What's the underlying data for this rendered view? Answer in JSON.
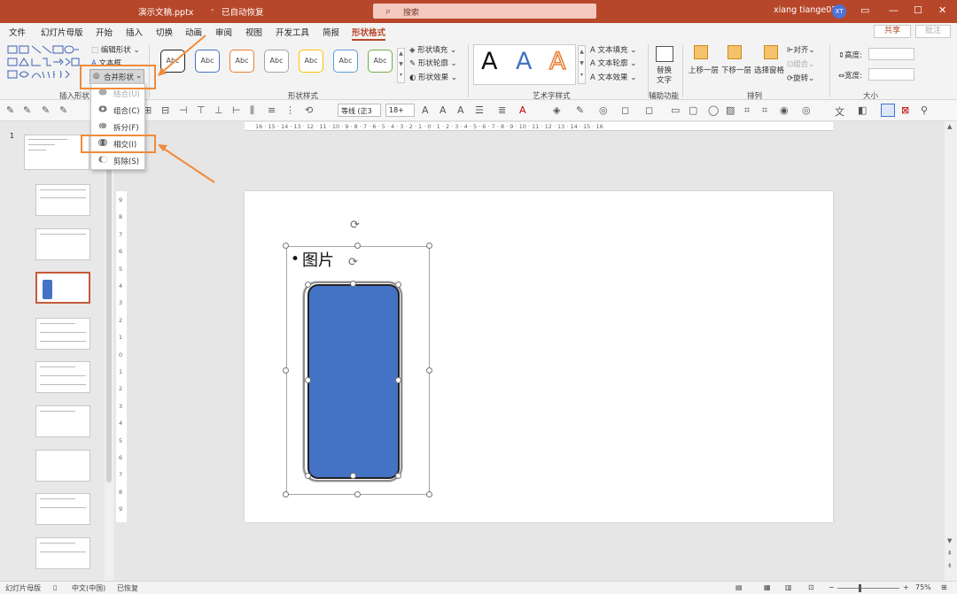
{
  "titlebar": {
    "filename": "演示文稿.pptx",
    "separator": "-",
    "autosave": "已自动恢复",
    "search_placeholder": "搜索",
    "username": "xiang tiange02",
    "avatar_initials": "XT"
  },
  "tabs": [
    "文件",
    "幻灯片母版",
    "开始",
    "插入",
    "切换",
    "动画",
    "审阅",
    "视图",
    "开发工具",
    "简报",
    "形状格式"
  ],
  "share_label": "共享",
  "comment_label": "批注",
  "ribbon": {
    "insert_shapes": {
      "label": "插入形状",
      "edit_shape": "编辑形状",
      "textbox": "文本框",
      "merge_shapes": "合并形状"
    },
    "shape_styles": {
      "label": "形状样式",
      "style_text": "Abc",
      "fill": "形状填充",
      "outline": "形状轮廓",
      "effects": "形状效果"
    },
    "wordart": {
      "label": "艺术字样式",
      "letter": "A",
      "text_fill": "文本填充",
      "text_outline": "文本轮廓",
      "text_effects": "文本效果"
    },
    "accessibility": {
      "label": "辅助功能",
      "alt_text_1": "替换",
      "alt_text_2": "文字"
    },
    "arrange": {
      "label": "排列",
      "bring_forward": "上移一层",
      "send_backward": "下移一层",
      "selection_pane": "选择窗格",
      "align": "对齐",
      "group": "组合",
      "rotate": "旋转"
    },
    "size": {
      "label": "大小",
      "height": "高度:",
      "width": "宽度:"
    }
  },
  "toolbar2": {
    "font_name": "等线 (正3",
    "font_size": "18+",
    "text_label": "文"
  },
  "merge_menu": {
    "items": [
      "结合(U)",
      "组合(C)",
      "拆分(F)",
      "相交(I)",
      "剪除(S)"
    ]
  },
  "thumbnails": {
    "first_number": "1"
  },
  "ruler_top": "16 · 15 · 14 · 13 · 12 · 11 · 10 · 9 · 8 · 7 · 6 · 5 · 4 · 3 · 2 · 1 · 0 · 1 · 2 · 3 · 4 · 5 · 6 · 7 · 8 · 9 · 10 · 11 · 12 · 13 · 14 · 15 · 16",
  "ruler_left": [
    "9",
    "8",
    "7",
    "6",
    "5",
    "4",
    "3",
    "2",
    "1",
    "0",
    "1",
    "2",
    "3",
    "4",
    "5",
    "6",
    "7",
    "8",
    "9"
  ],
  "slide": {
    "bullet": "•",
    "text": "图片"
  },
  "status": {
    "view": "幻灯片母版",
    "lang": "中文(中国)",
    "recovered": "已恢复",
    "zoom": "75%"
  },
  "colors": {
    "accent": "#b7472a",
    "phone_fill": "#4472c4",
    "highlight": "#f08b3a"
  }
}
